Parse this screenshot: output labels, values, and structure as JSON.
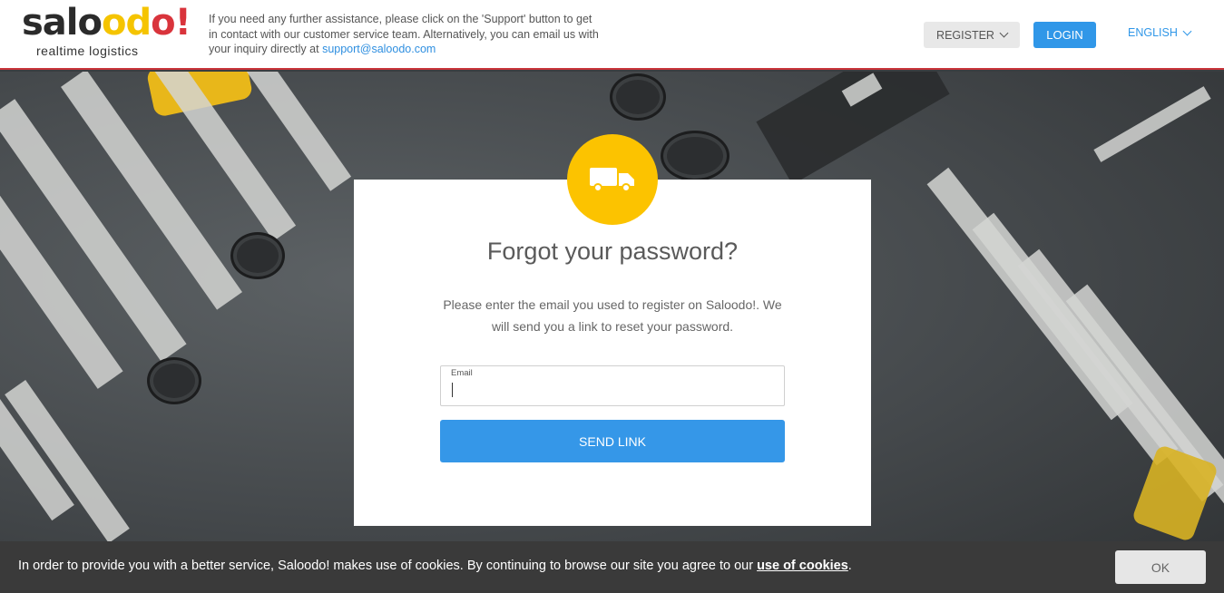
{
  "brand": {
    "logo_parts": [
      "salo",
      "od",
      "o",
      "!"
    ],
    "tagline": "realtime logistics",
    "colors": {
      "yellow": "#fcc300",
      "red": "#d9343c",
      "blue": "#3097e8"
    }
  },
  "header": {
    "help_text": "If you need any further assistance, please click on the 'Support' button to get in contact with our customer service team. Alternatively, you can email us with your inquiry directly at ",
    "support_email": "support@saloodo.com",
    "register_label": "REGISTER",
    "login_label": "LOGIN",
    "language_label": "ENGLISH"
  },
  "card": {
    "icon": "truck-icon",
    "title": "Forgot your password?",
    "description": "Please enter the email you used to register on Saloodo!. We will send you a link to reset your password.",
    "email_label": "Email",
    "email_value": "",
    "send_label": "SEND LINK"
  },
  "cookie_bar": {
    "text": "In order to provide you with a better service, Saloodo! makes use of cookies. By continuing to browse our site you agree to our ",
    "link_text": "use of cookies",
    "suffix": ".",
    "ok_label": "OK"
  }
}
